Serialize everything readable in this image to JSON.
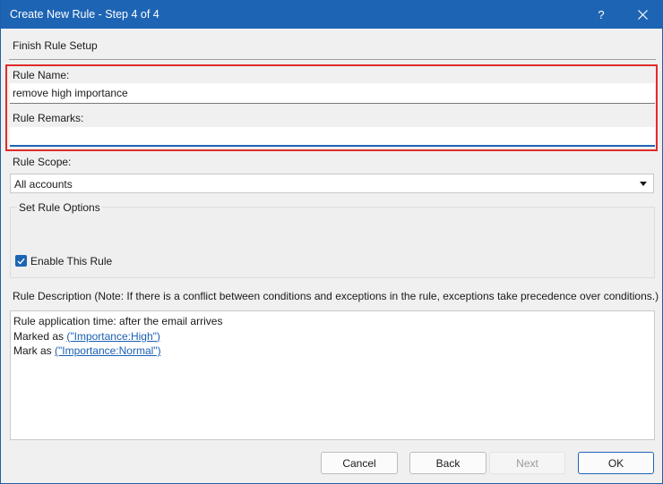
{
  "window": {
    "title": "Create New Rule - Step 4 of 4",
    "help_label": "?"
  },
  "section_title": "Finish Rule Setup",
  "rule_name": {
    "label": "Rule Name:",
    "value": "remove high importance"
  },
  "rule_remarks": {
    "label": "Rule Remarks:",
    "value": ""
  },
  "rule_scope": {
    "label": "Rule Scope:",
    "selected": "All accounts"
  },
  "options": {
    "title": "Set Rule Options",
    "enable_rule_label": "Enable This Rule",
    "enable_rule_checked": true
  },
  "description": {
    "label": "Rule Description (Note: If there is a conflict between conditions and exceptions in the rule, exceptions take precedence over conditions.)",
    "line1": "Rule application time: after the email arrives",
    "line2_prefix": "Marked as ",
    "line2_link": "(\"Importance:High\")",
    "line3_prefix": "Mark as ",
    "line3_link": "(\"Importance:Normal\")"
  },
  "buttons": {
    "cancel": "Cancel",
    "back": "Back",
    "next": "Next",
    "ok": "OK"
  },
  "colors": {
    "titlebar": "#1e64b4",
    "highlight_box": "#e02b2b",
    "link": "#1a5fb4"
  }
}
